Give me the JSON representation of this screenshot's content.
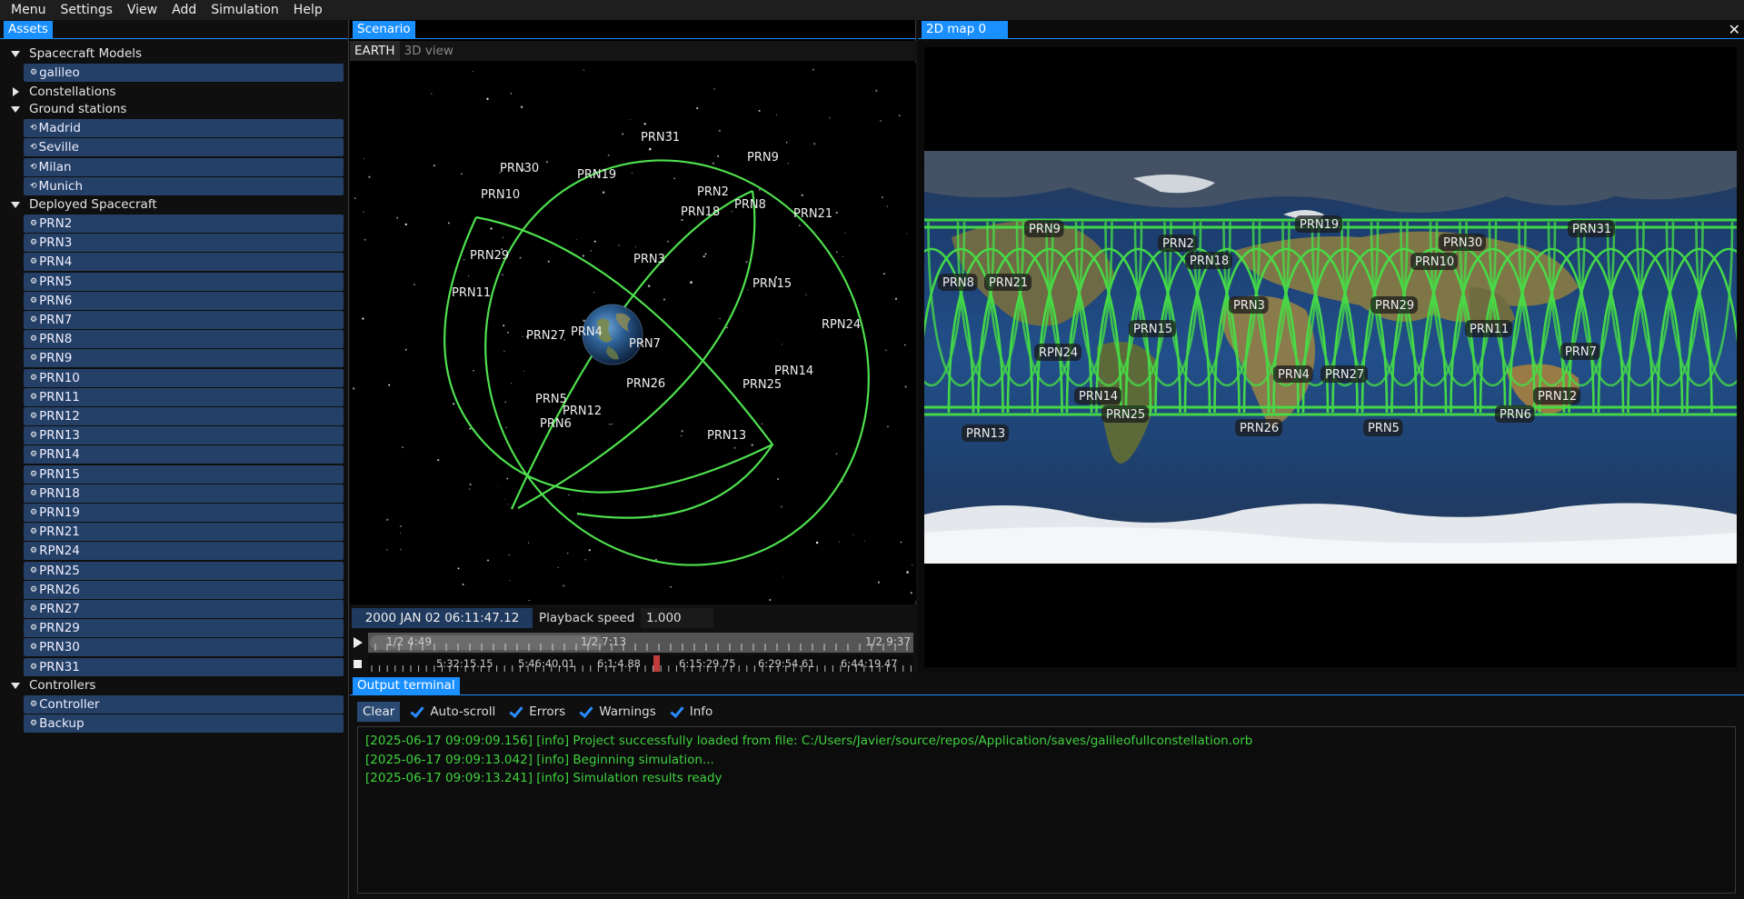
{
  "menu": [
    "Menu",
    "Settings",
    "View",
    "Add",
    "Simulation",
    "Help"
  ],
  "assets": {
    "tab": "Assets",
    "groups": [
      {
        "label": "Spacecraft Models",
        "expanded": true
      },
      {
        "label": "Constellations",
        "expanded": false
      },
      {
        "label": "Ground stations",
        "expanded": true
      },
      {
        "label": "Deployed Spacecraft",
        "expanded": true
      },
      {
        "label": "Controllers",
        "expanded": true
      }
    ],
    "models": [
      "galileo"
    ],
    "ground_stations": [
      "Madrid",
      "Seville",
      "Milan",
      "Munich"
    ],
    "deployed": [
      "PRN2",
      "PRN3",
      "PRN4",
      "PRN5",
      "PRN6",
      "PRN7",
      "PRN8",
      "PRN9",
      "PRN10",
      "PRN11",
      "PRN12",
      "PRN13",
      "PRN14",
      "PRN15",
      "PRN18",
      "PRN19",
      "PRN21",
      "RPN24",
      "PRN25",
      "PRN26",
      "PRN27",
      "PRN29",
      "PRN30",
      "PRN31"
    ],
    "controllers": [
      "Controller",
      "Backup"
    ]
  },
  "scenario": {
    "tab": "Scenario",
    "subtabs": [
      "EARTH",
      "3D view"
    ],
    "orbit_labels": [
      "PRN31",
      "PRN9",
      "PRN30",
      "PRN19",
      "PRN10",
      "PRN2",
      "PRN8",
      "PRN18",
      "PRN21",
      "PRN29",
      "PRN3",
      "PRN15",
      "PRN11",
      "RPN24",
      "PRN27",
      "PRN4",
      "PRN7",
      "PRN14",
      "PRN26",
      "PRN25",
      "PRN5",
      "PRN12",
      "PRN6",
      "PRN13"
    ],
    "date": "2000 JAN 02 06:11:47.12",
    "playback_label": "Playback speed",
    "playback_value": "1.000",
    "timeline_top": [
      "1/2  4:49",
      "1/2  7:13",
      "1/2  9:37"
    ],
    "timeline_bottom": [
      "5:32:15.15",
      "5:46:40.01",
      "6:1:4.88",
      "6:15:29.75",
      "6:29:54.61",
      "6:44:19.47"
    ]
  },
  "map2d": {
    "tab": "2D map 0",
    "labels": [
      "PRN9",
      "PRN19",
      "PRN31",
      "PRN2",
      "PRN30",
      "PRN8",
      "PRN21",
      "PRN18",
      "PRN10",
      "PRN3",
      "PRN29",
      "PRN15",
      "PRN11",
      "RPN24",
      "PRN7",
      "PRN4",
      "PRN27",
      "PRN14",
      "PRN12",
      "PRN25",
      "PRN6",
      "PRN13",
      "PRN26",
      "PRN5"
    ]
  },
  "terminal": {
    "tab": "Output terminal",
    "clear": "Clear",
    "checks": [
      "Auto-scroll",
      "Errors",
      "Warnings",
      "Info"
    ],
    "log": [
      "[2025-06-17 09:09:09.156] [info] Project successfully loaded from file: C:/Users/Javier/source/repos/Application/saves/galileofullconstellation.orb",
      "[2025-06-17 09:09:13.042] [info] Beginning simulation...",
      "[2025-06-17 09:09:13.241] [info] Simulation results ready"
    ]
  },
  "colors": {
    "accent": "#1a8fff",
    "item_bg": "#254066",
    "orbit": "#4ee04e",
    "log": "#3fd23f"
  }
}
